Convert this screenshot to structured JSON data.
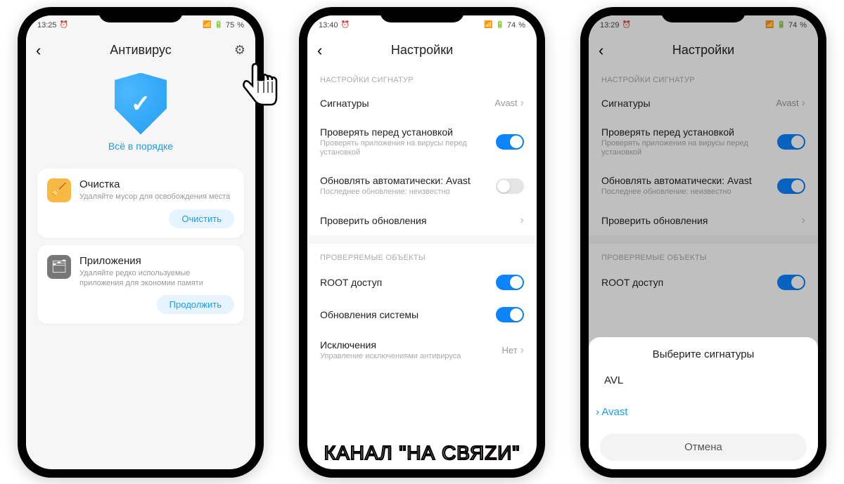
{
  "phone1": {
    "status": {
      "time": "13:25",
      "alarm": "⏰",
      "signal": "📶",
      "battery_pct": "75",
      "battery_icon": "🔋"
    },
    "title": "Антивирус",
    "hero_ok": "Всё в порядке",
    "cleanup": {
      "title": "Очистка",
      "subtitle": "Удаляйте мусор для освобождения места",
      "button": "Очистить"
    },
    "apps": {
      "title": "Приложения",
      "subtitle": "Удаляйте редко используемые приложения для экономии памяти",
      "button": "Продолжить"
    }
  },
  "phone2": {
    "status": {
      "time": "13:40",
      "alarm": "⏰",
      "battery_pct": "74"
    },
    "title": "Настройки",
    "section1": "НАСТРОЙКИ СИГНАТУР",
    "signatures": {
      "label": "Сигнатуры",
      "value": "Avast"
    },
    "check_before": {
      "label": "Проверять перед установкой",
      "sub": "Проверять приложения на вирусы перед установкой",
      "on": true
    },
    "autoupdate": {
      "label": "Обновлять автоматически: Avast",
      "sub": "Последнее обновление: неизвестно",
      "on": false
    },
    "check_updates": {
      "label": "Проверить обновления"
    },
    "section2": "ПРОВЕРЯЕМЫЕ ОБЪЕКТЫ",
    "root": {
      "label": "ROOT доступ",
      "on": true
    },
    "sysupd": {
      "label": "Обновления системы",
      "on": true
    },
    "exceptions": {
      "label": "Исключения",
      "sub": "Управление исключениями антивируса",
      "value": "Нет"
    }
  },
  "phone3": {
    "status": {
      "time": "13:29",
      "alarm": "⏰",
      "battery_pct": "74"
    },
    "title": "Настройки",
    "section1": "НАСТРОЙКИ СИГНАТУР",
    "signatures": {
      "label": "Сигнатуры",
      "value": "Avast"
    },
    "check_before": {
      "label": "Проверять перед установкой",
      "sub": "Проверять приложения на вирусы перед установкой",
      "on": true
    },
    "autoupdate": {
      "label": "Обновлять автоматически: Avast",
      "sub": "Последнее обновление: неизвестно",
      "on": true
    },
    "check_updates": {
      "label": "Проверить обновления"
    },
    "section2": "ПРОВЕРЯЕМЫЕ ОБЪЕКТЫ",
    "root": {
      "label": "ROOT доступ",
      "on": true
    },
    "sheet": {
      "title": "Выберите сигнатуры",
      "opt1": "AVL",
      "opt2": "Avast",
      "cancel": "Отмена"
    }
  },
  "watermark": {
    "pre": "КАНАЛ \"НА СВЯ",
    "z": "Z",
    "post": "И\""
  }
}
